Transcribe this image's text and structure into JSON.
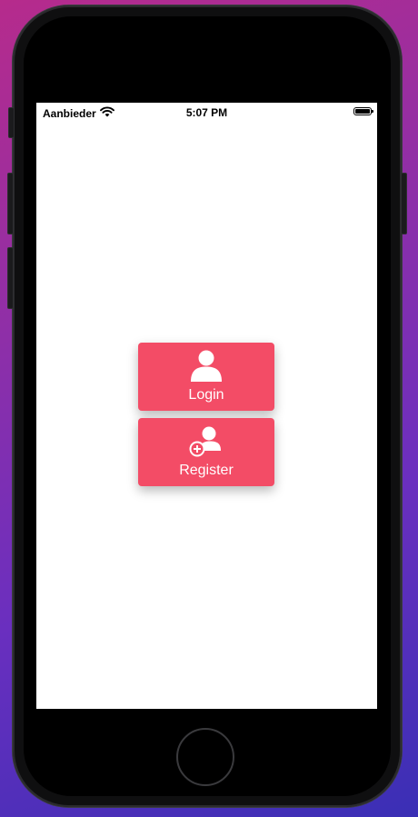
{
  "status_bar": {
    "carrier": "Aanbieder",
    "time": "5:07 PM",
    "wifi_icon": "wifi-icon",
    "battery_icon": "battery-icon"
  },
  "main": {
    "login_button": {
      "label": "Login",
      "icon": "user-icon"
    },
    "register_button": {
      "label": "Register",
      "icon": "add-user-icon"
    }
  },
  "colors": {
    "accent": "#f34c66",
    "screen_background": "#ffffff",
    "device_frame": "#000000"
  }
}
